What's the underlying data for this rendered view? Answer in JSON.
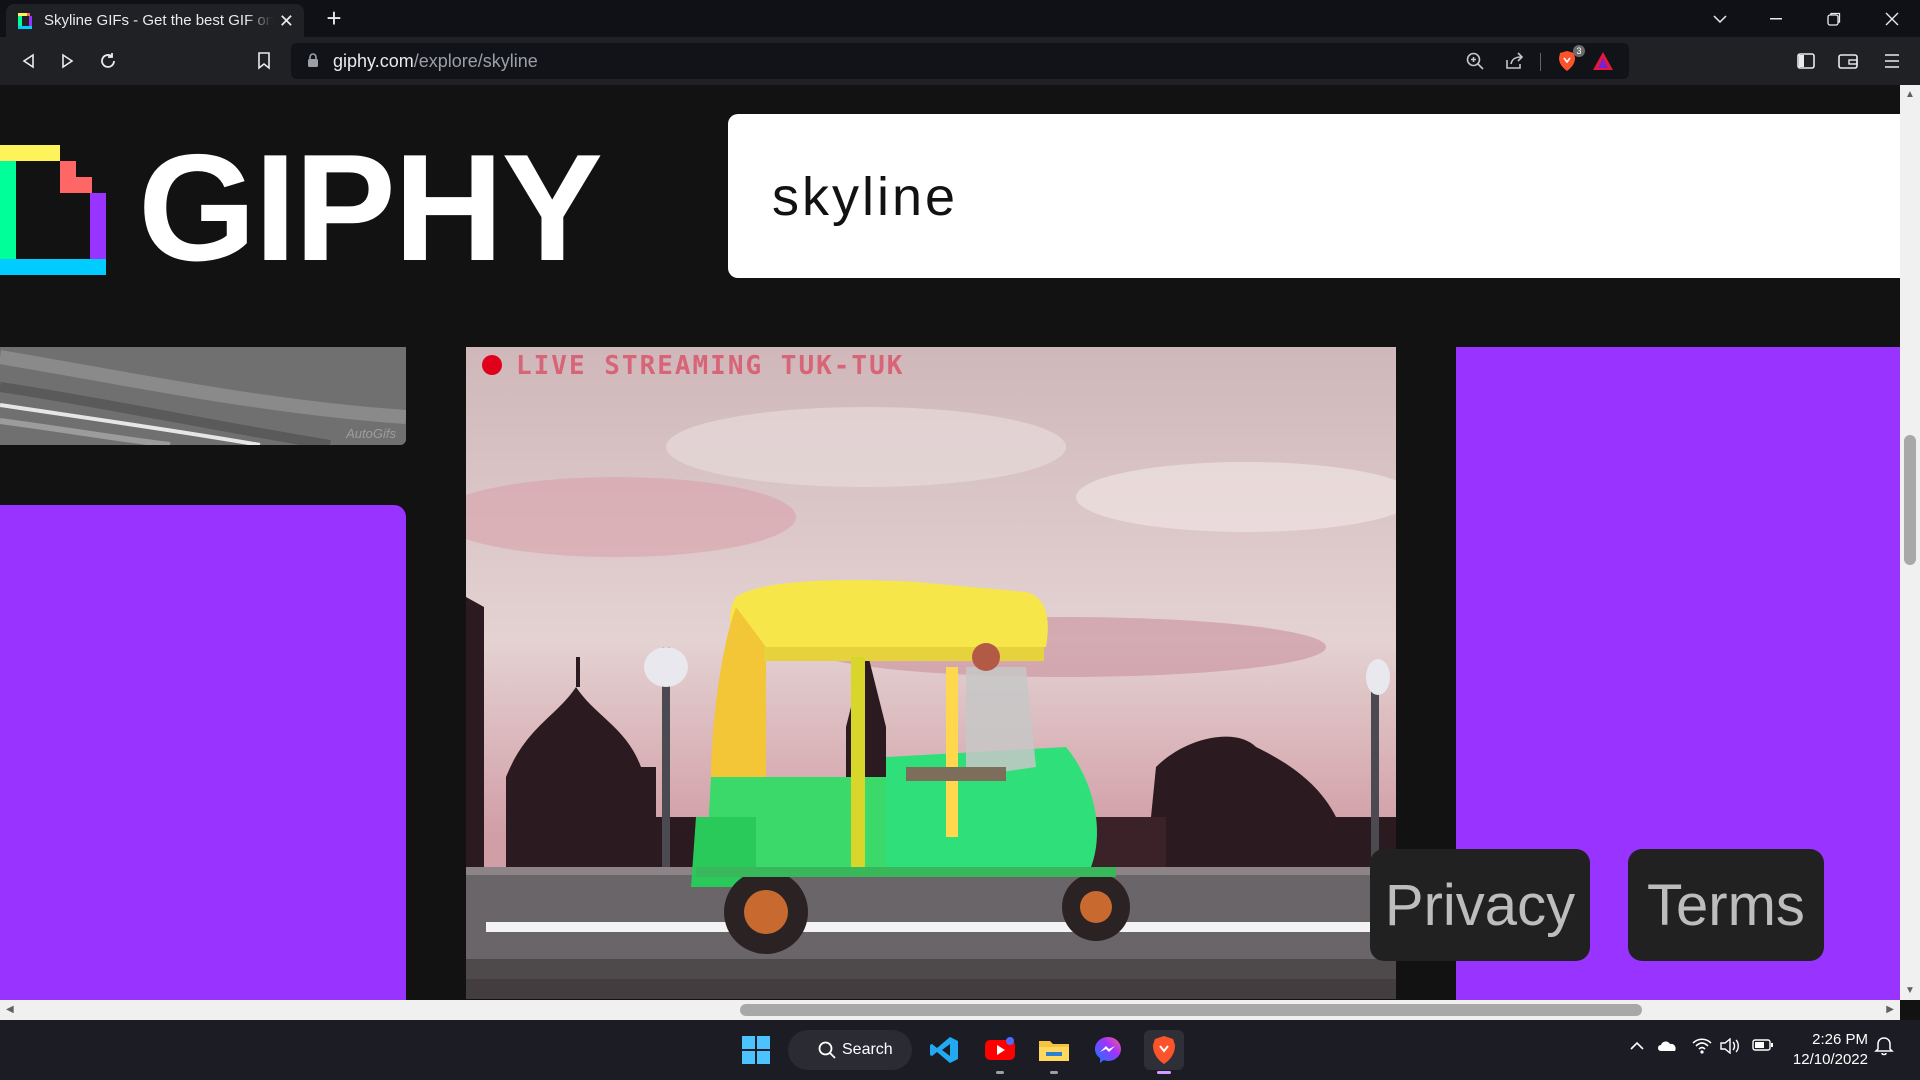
{
  "browser": {
    "tab_title": "Skyline GIFs - Get the best GIF on GIPHY",
    "new_tab_label": "+",
    "url_domain": "giphy.com",
    "url_path": "/explore/skyline",
    "brave_shield_count": "3"
  },
  "page": {
    "logo_text": "GIPHY",
    "search_value": "skyline",
    "gif_caption": "LIVE STREAMING TUK-TUK",
    "thumb_watermark": "AutoGifs",
    "privacy_label": "Privacy",
    "terms_label": "Terms"
  },
  "taskbar": {
    "search_label": "Search",
    "time": "2:26 PM",
    "date": "12/10/2022"
  },
  "colors": {
    "page_bg": "#121212",
    "purple": "#9933ff",
    "chrome_bg": "#202124",
    "taskbar_bg": "#1c1c24"
  }
}
